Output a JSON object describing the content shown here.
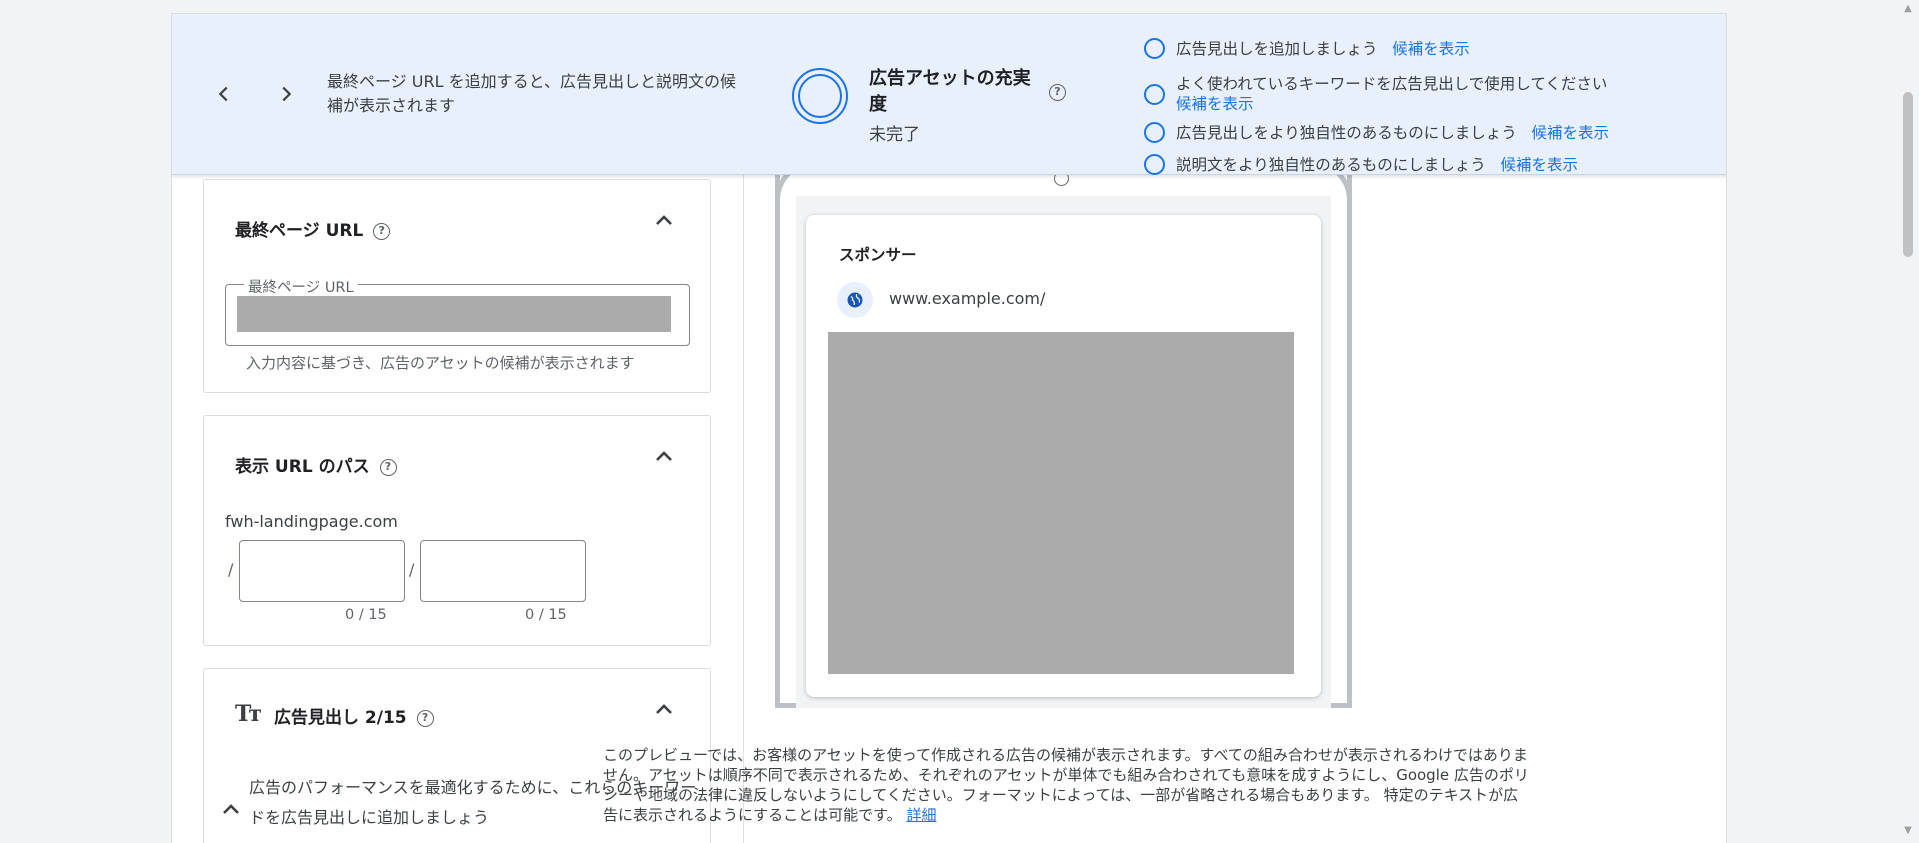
{
  "banner": {
    "message": "最終ページ URL を追加すると、広告見出しと説明文の候補が表示されます",
    "strength_title": "広告アセットの充実度",
    "strength_status": "未完了",
    "checklist": [
      {
        "text": "広告見出しを追加しましょう",
        "link": "候補を表示"
      },
      {
        "text": "よく使われているキーワードを広告見出しで使用してください",
        "link": "候補を表示"
      },
      {
        "text": "広告見出しをより独自性のあるものにしましょう",
        "link": "候補を表示"
      },
      {
        "text": "説明文をより独自性のあるものにしましょう",
        "link": "候補を表示"
      }
    ]
  },
  "final_url": {
    "title": "最終ページ URL",
    "field_label": "最終ページ URL",
    "hint": "入力内容に基づき、広告のアセットの候補が表示されます"
  },
  "display_path": {
    "title": "表示 URL のパス",
    "domain": "fwh-landingpage.com",
    "separator": "/",
    "path1_counter": "0 / 15",
    "path2_counter": "0 / 15"
  },
  "headlines": {
    "title": "広告見出し 2/15",
    "icon_text": "Tт",
    "keyword_hint": "広告のパフォーマンスを最適化するために、これらのキーワードを広告見出しに追加しましょう"
  },
  "preview": {
    "sponsor_label": "スポンサー",
    "url": "www.example.com/",
    "disclaimer": "このプレビューでは、お客様のアセットを使って作成される広告の候補が表示されます。すべての組み合わせが表示されるわけではありません。アセットは順序不同で表示されるため、それぞれのアセットが単体でも組み合わされても意味を成すようにし、Google 広告のポリシーや地域の法律に違反しないようにしてください。フォーマットによっては、一部が省略される場合もあります。 特定のテキストが広告に表示されるようにすることは可能です。",
    "details_link": "詳細"
  },
  "icons": {
    "prev": "chevron-left-icon",
    "next": "chevron-right-icon",
    "help": "help-icon",
    "collapse": "chevron-up-icon",
    "globe": "globe-icon"
  },
  "colors": {
    "banner_bg": "#e8f0fe",
    "accent": "#1a73e8",
    "placeholder_gray": "#ababab"
  }
}
